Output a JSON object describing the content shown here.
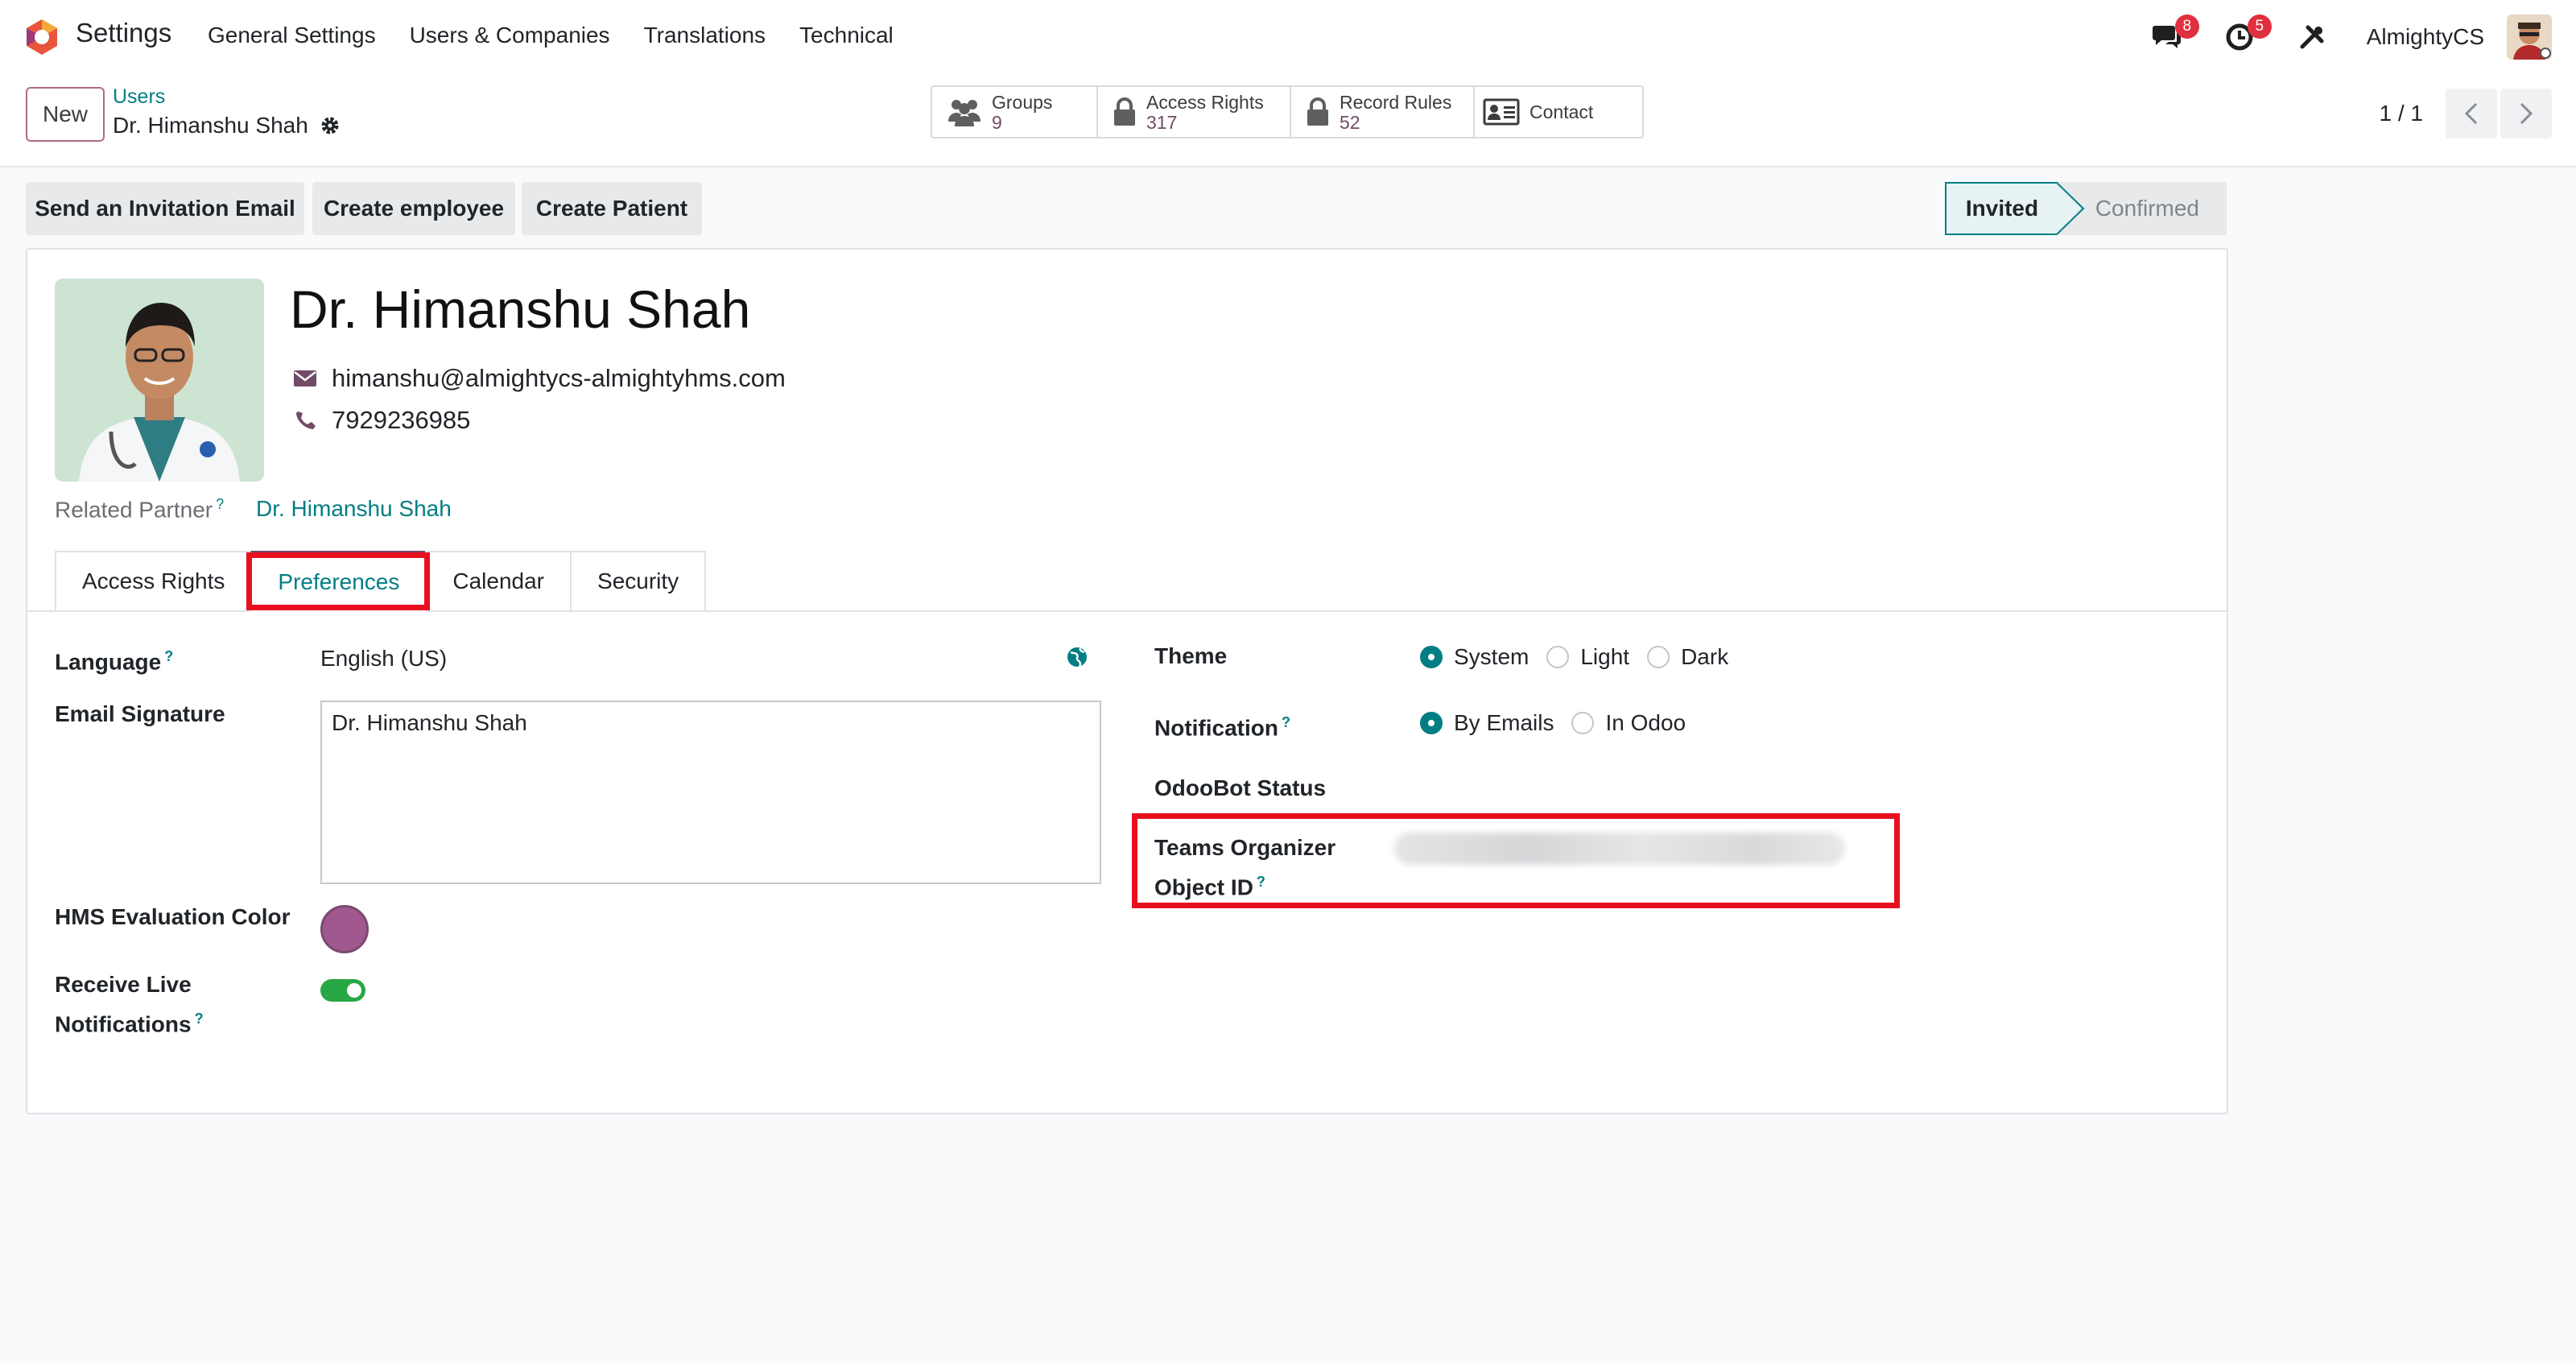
{
  "navbar": {
    "app_name": "Settings",
    "menu": [
      "General Settings",
      "Users & Companies",
      "Translations",
      "Technical"
    ],
    "messages_badge": "8",
    "activities_badge": "5",
    "company": "AlmightyCS"
  },
  "control_panel": {
    "new_label": "New",
    "breadcrumb_parent": "Users",
    "breadcrumb_current": "Dr. Himanshu Shah",
    "smart_buttons": [
      {
        "label": "Groups",
        "value": "9",
        "icon": "users-icon"
      },
      {
        "label": "Access Rights",
        "value": "317",
        "icon": "lock-icon"
      },
      {
        "label": "Record Rules",
        "value": "52",
        "icon": "lock-icon"
      },
      {
        "label": "Contact",
        "value": "",
        "icon": "contact-card-icon"
      }
    ],
    "pager": "1 / 1"
  },
  "actions": {
    "send_invitation": "Send an Invitation Email",
    "create_employee": "Create employee",
    "create_patient": "Create Patient"
  },
  "status": {
    "active": "Invited",
    "next": "Confirmed"
  },
  "user": {
    "name": "Dr. Himanshu Shah",
    "email": "himanshu@almightycs-almightyhms.com",
    "phone": "7929236985",
    "related_partner_label": "Related Partner",
    "related_partner": "Dr. Himanshu Shah"
  },
  "tabs": [
    "Access Rights",
    "Preferences",
    "Calendar",
    "Security"
  ],
  "preferences": {
    "language_label": "Language",
    "language_value": "English (US)",
    "signature_label": "Email Signature",
    "signature_value": "Dr. Himanshu Shah",
    "hms_color_label": "HMS Evaluation Color",
    "receive_live_label_1": "Receive Live",
    "receive_live_label_2": "Notifications",
    "theme_label": "Theme",
    "theme_options": [
      "System",
      "Light",
      "Dark"
    ],
    "theme_selected": "System",
    "notification_label": "Notification",
    "notification_options": [
      "By Emails",
      "In Odoo"
    ],
    "notification_selected": "By Emails",
    "odoobot_label": "OdooBot Status",
    "teams_label_1": "Teams Organizer",
    "teams_label_2": "Object ID"
  },
  "colors": {
    "primary": "#714b67",
    "accent": "#017e84",
    "highlight": "#e8101f",
    "hms_color": "#a0588f"
  }
}
